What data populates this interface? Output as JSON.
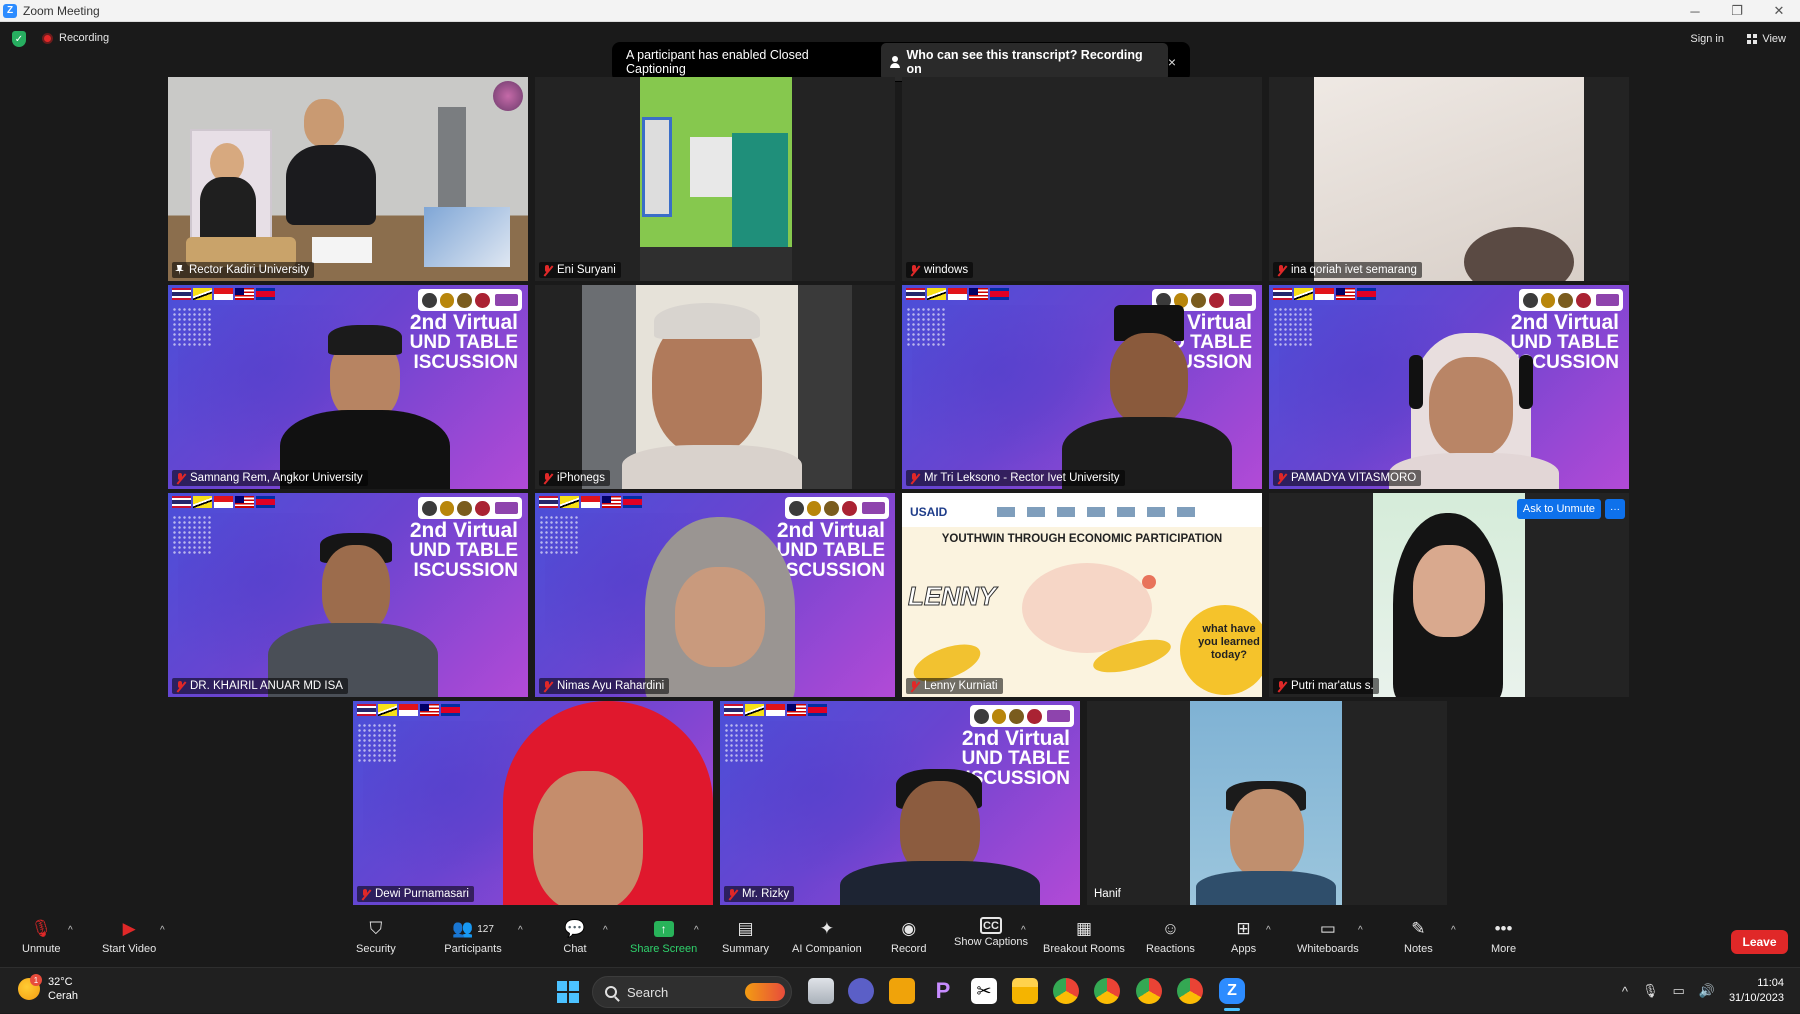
{
  "window": {
    "title": "Zoom Meeting",
    "controls": [
      "─",
      "❐",
      "✕"
    ]
  },
  "topbar": {
    "recording_label": "Recording",
    "signin_label": "Sign in",
    "view_label": "View"
  },
  "banner": {
    "message": "A participant has enabled Closed Captioning",
    "who_label": "Who can see this transcript? Recording on",
    "close": "×"
  },
  "gallery": {
    "slide_title_l1": "2nd Virtual",
    "slide_title_l2": "UND TABLE",
    "slide_title_l3": "ISCUSSION",
    "slide_title_l2_wide": "OUND TABLE",
    "slide_title_l3_wide": "DISCUSSION",
    "tiles": [
      {
        "name": "Rector Kadiri University",
        "muted": false,
        "pinned": true,
        "active": true
      },
      {
        "name": "Eni Suryani",
        "muted": true
      },
      {
        "name": "windows",
        "muted": true
      },
      {
        "name": "ina qoriah ivet semarang",
        "muted": true
      },
      {
        "name": "Samnang Rem, Angkor University",
        "muted": true
      },
      {
        "name": "iPhonegs",
        "muted": true
      },
      {
        "name": "Mr Tri Leksono - Rector Ivet University",
        "muted": true
      },
      {
        "name": "PAMADYA VITASMORO",
        "muted": true
      },
      {
        "name": "DR. KHAIRIL ANUAR MD ISA",
        "muted": true
      },
      {
        "name": "Nimas Ayu Rahardini",
        "muted": true
      },
      {
        "name": "Lenny Kurniati",
        "muted": true
      },
      {
        "name": "Putri mar'atus s.",
        "muted": true
      },
      {
        "name": "Dewi Purnamasari",
        "muted": true
      },
      {
        "name": "Mr. Rizky",
        "muted": true
      },
      {
        "name": "Hanif",
        "muted": false
      }
    ],
    "slide_usaid_title": "YOUTHWIN THROUGH ECONOMIC PARTICIPATION",
    "slide_usaid_brand": "USAID",
    "slide_usaid_name": "LENNY",
    "slide_usaid_bubble": "what have you learned today?",
    "ask_to_unmute": "Ask to Unmute",
    "more_dots": "···"
  },
  "toolbar": {
    "unmute": "Unmute",
    "start_video": "Start Video",
    "security": "Security",
    "participants": "Participants",
    "participants_count": "127",
    "chat": "Chat",
    "share_screen": "Share Screen",
    "summary": "Summary",
    "ai_companion": "AI Companion",
    "record": "Record",
    "show_captions": "Show Captions",
    "breakout_rooms": "Breakout Rooms",
    "reactions": "Reactions",
    "apps": "Apps",
    "whiteboards": "Whiteboards",
    "notes": "Notes",
    "more": "More",
    "leave": "Leave"
  },
  "taskbar": {
    "weather_temp": "32°C",
    "weather_desc": "Cerah",
    "weather_badge": "1",
    "search_label": "Search",
    "time": "11:04",
    "date": "31/10/2023"
  }
}
